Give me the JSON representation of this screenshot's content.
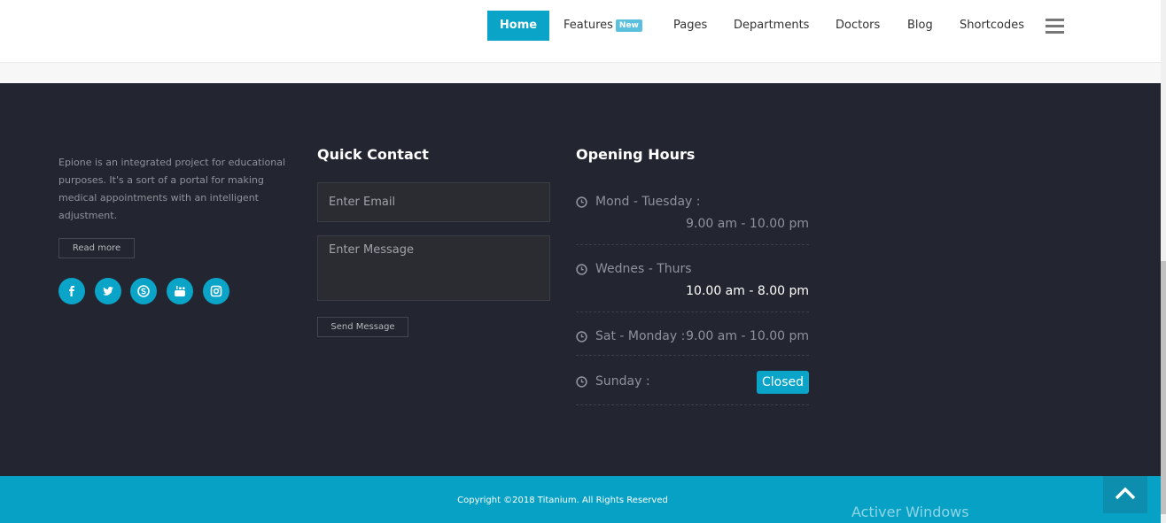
{
  "nav": {
    "items": [
      {
        "label": "Home",
        "active": true
      },
      {
        "label": "Features",
        "badge": "New"
      },
      {
        "label": "Pages"
      },
      {
        "label": "Departments"
      },
      {
        "label": "Doctors"
      },
      {
        "label": "Blog"
      },
      {
        "label": "Shortcodes"
      }
    ],
    "menu_icon": "hamburger-icon"
  },
  "about": {
    "text": "Epione is an integrated project for educational purposes. It's a sort of a portal for making medical appointments with an intelligent adjustment.",
    "read_more": "Read more",
    "socials": [
      "facebook-icon",
      "twitter-icon",
      "skype-icon",
      "youtube-icon",
      "instagram-icon"
    ]
  },
  "quick_contact": {
    "title": "Quick Contact",
    "email_placeholder": "Enter Email",
    "message_placeholder": "Enter Message",
    "send_label": "Send Message"
  },
  "opening_hours": {
    "title": "Opening Hours",
    "rows": [
      {
        "day": "Mond - Tuesday :",
        "time": "9.00 am - 10.00 pm"
      },
      {
        "day": "Wednes - Thurs",
        "time": "10.00 am - 8.00 pm"
      },
      {
        "day": "Sat - Monday :",
        "time": "9.00 am - 10.00 pm"
      },
      {
        "day": "Sunday :",
        "time": "Closed"
      }
    ]
  },
  "footer": {
    "copyright": "Copyright ©2018 Titanium. All Rights Reserved",
    "windows_notice": "Activer Windows"
  },
  "colors": {
    "accent": "#0aa4c8",
    "footer_bg": "#232630",
    "bottom_bar": "#07a1c6"
  }
}
